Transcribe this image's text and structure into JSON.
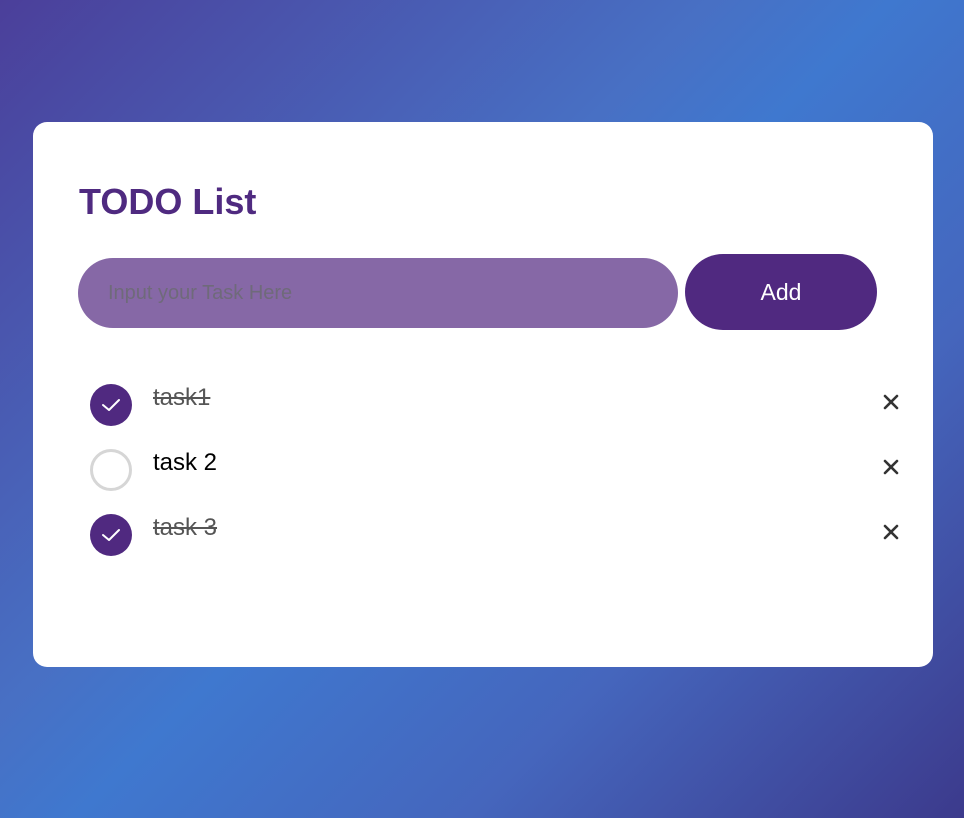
{
  "colors": {
    "accent": "#502980",
    "title": "#4f2a80",
    "input_bg": "#8668a6",
    "card_bg": "#ffffff"
  },
  "header": {
    "title": "TODO List"
  },
  "form": {
    "input_value": "",
    "input_placeholder": "Input your Task Here",
    "add_label": "Add"
  },
  "tasks": [
    {
      "label": "task1",
      "done": true,
      "check_icon": "checkmark-icon",
      "delete_icon": "close-icon"
    },
    {
      "label": "task 2",
      "done": false,
      "check_icon": "checkmark-icon",
      "delete_icon": "close-icon"
    },
    {
      "label": "task 3",
      "done": true,
      "check_icon": "checkmark-icon",
      "delete_icon": "close-icon"
    }
  ]
}
